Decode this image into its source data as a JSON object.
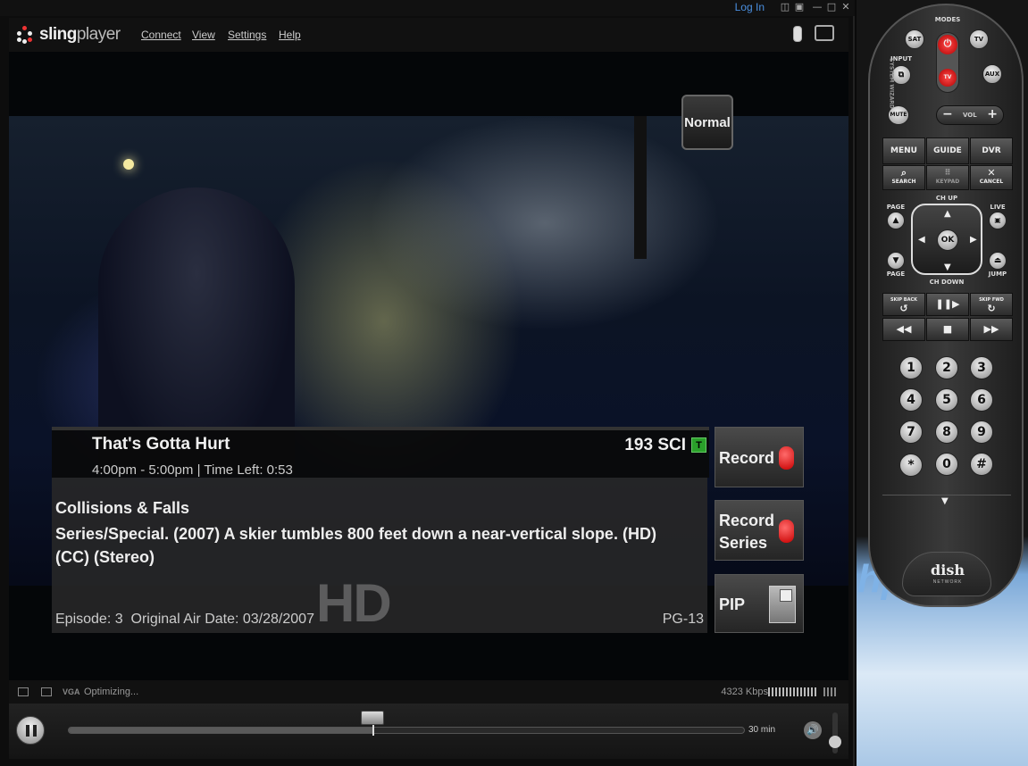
{
  "window": {
    "login_label": "Log In"
  },
  "app": {
    "logo": {
      "part1": "sling",
      "part2": "player"
    },
    "menu": [
      "Connect",
      "View",
      "Settings",
      "Help"
    ]
  },
  "video": {
    "normal_label": "Normal"
  },
  "program": {
    "title": "That's Gotta Hurt",
    "time": "4:00pm - 5:00pm",
    "time_left": "Time Left: 0:53",
    "channel": "193 SCI",
    "channel_badge": "T",
    "episode_title": "Collisions & Falls",
    "description": " Series/Special.  (2007) A skier tumbles 800 feet down a near-vertical slope. (HD) (CC) (Stereo)",
    "hd_watermark": "HD",
    "episode": "Episode: 3",
    "original_air_date": "Original Air Date: 03/28/2007",
    "rating": "PG-13"
  },
  "side_buttons": {
    "record": "Record",
    "record_series_1": "Record",
    "record_series_2": "Series",
    "pip": "PIP"
  },
  "status": {
    "mode": "VGA",
    "text": "Optimizing...",
    "bitrate": "4323 Kbps"
  },
  "controls": {
    "duration": "30 min",
    "progress_percent": 45
  },
  "remote": {
    "modes": "MODES",
    "sat": "SAT",
    "tv": "TV",
    "power_tv": "TV",
    "aux": "AUX",
    "input": "INPUT",
    "mute": "MUTE",
    "vol": "VOL",
    "vol_minus": "−",
    "vol_plus": "+",
    "menu": "MENU",
    "guide": "GUIDE",
    "dvr": "DVR",
    "search": "SEARCH",
    "keypad": "KEYPAD",
    "cancel": "CANCEL",
    "ch_up": "CH UP",
    "ch_down": "CH DOWN",
    "page_up": "PAGE",
    "page_down": "PAGE",
    "live": "LIVE",
    "jump": "JUMP",
    "ok": "OK",
    "skip_back": "SKIP BACK",
    "skip_fwd": "SKIP FWD",
    "digits": [
      "1",
      "2",
      "3",
      "4",
      "5",
      "6",
      "7",
      "8",
      "9",
      "*",
      "0",
      "#"
    ],
    "side_label": "SYSTEM WIZARD",
    "brand": "dish",
    "brand_sub": "NETWORK"
  },
  "colors": {
    "accent_blue": "#4a8fe0",
    "record_red": "#c80000",
    "channel_green": "#2aa02a"
  }
}
